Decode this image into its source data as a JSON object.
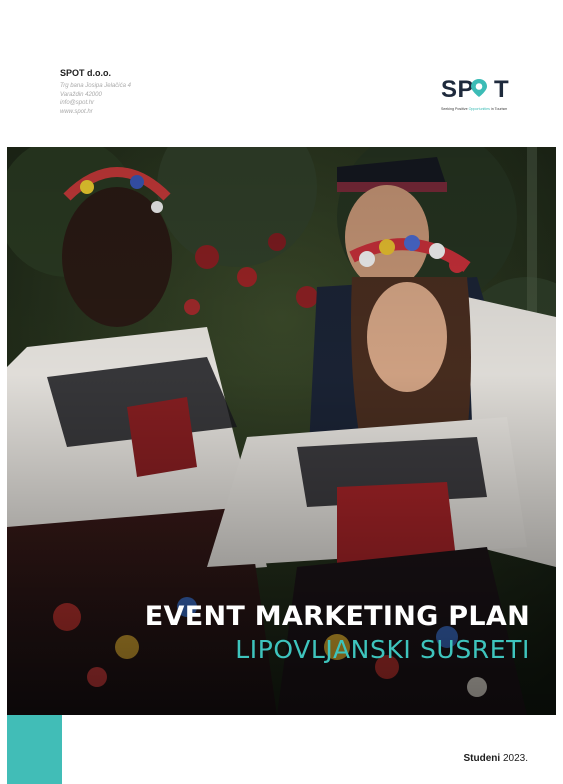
{
  "company": {
    "name": "SPOT d.o.o.",
    "address_line": "Trg bana Josipa Jelačića 4",
    "city_line": "Varaždin 42000",
    "email": "info@spot.hr",
    "website": "www.spot.hr"
  },
  "logo": {
    "wordmark": "SPOT",
    "tagline_before": "Seeking Positive ",
    "tagline_highlight": "Opportunities",
    "tagline_after": " in Tourism",
    "colors": {
      "dark": "#1e2a3c",
      "teal": "#3cbcb6"
    }
  },
  "cover": {
    "title": "EVENT MARKETING PLAN",
    "subtitle": "LIPOVLJANSKI SUSRETI",
    "image_icon": "folk-dancers-photo"
  },
  "footer": {
    "month": "Studeni",
    "year": "2023.",
    "accent_color": "#41bdb7"
  }
}
